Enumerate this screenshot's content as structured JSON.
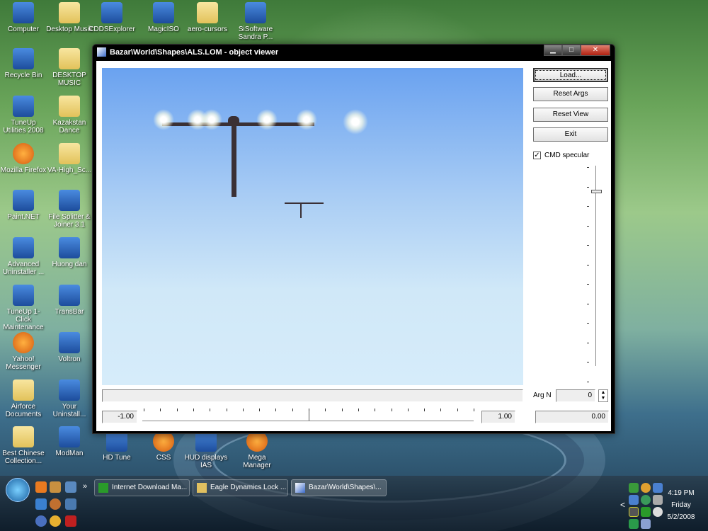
{
  "desktop_icons": [
    {
      "label": "Computer",
      "kind": "computer-icon"
    },
    {
      "label": "Desktop Musik",
      "kind": "folder-icon"
    },
    {
      "label": "CDDSExplorer",
      "kind": "modman-icon"
    },
    {
      "label": "MagicISO",
      "kind": "disc-icon"
    },
    {
      "label": "aero-cursors",
      "kind": "folder-icon"
    },
    {
      "label": "SiSoftware Sandra P...",
      "kind": "sandra-icon"
    },
    {
      "label": "Recycle Bin",
      "kind": "recycle-bin-icon"
    },
    {
      "label": "DESKTOP MUSIC",
      "kind": "folder-icon"
    },
    {
      "label": "TuneUp Utilities 2008",
      "kind": "tuneup-icon"
    },
    {
      "label": "Kazakstan Dance",
      "kind": "folder-icon"
    },
    {
      "label": "Mozilla Firefox",
      "kind": "firefox-icon"
    },
    {
      "label": "VA-High_Sc...",
      "kind": "folder-icon"
    },
    {
      "label": "Paint.NET",
      "kind": "paint-icon"
    },
    {
      "label": "File Splitter & Joiner 3.1",
      "kind": "file-splitter-icon"
    },
    {
      "label": "Advanced Uninstaller ...",
      "kind": "uninstaller-icon"
    },
    {
      "label": "Huong dan",
      "kind": "word-doc-icon"
    },
    {
      "label": "TuneUp 1-Click Maintenance",
      "kind": "tuneup-maintenance-icon"
    },
    {
      "label": "TransBar",
      "kind": "transbar-icon"
    },
    {
      "label": "Yahoo! Messenger",
      "kind": "yahoo-icon"
    },
    {
      "label": "Voltron",
      "kind": "text-file-icon"
    },
    {
      "label": "Airforce Documents",
      "kind": "folder-icon"
    },
    {
      "label": "Your Uninstall...",
      "kind": "your-uninstaller-icon"
    },
    {
      "label": "Best Chinese Collection...",
      "kind": "folder-icon"
    },
    {
      "label": "ModMan",
      "kind": "modman-icon"
    },
    {
      "label": "HD Tune",
      "kind": "hdtune-icon"
    },
    {
      "label": "CSS",
      "kind": "css-icon"
    },
    {
      "label": "HUD displays IAS",
      "kind": "word-doc-icon"
    },
    {
      "label": "Mega Manager",
      "kind": "mega-manager-icon"
    }
  ],
  "window": {
    "title": "Bazar\\World\\Shapes\\ALS.LOM - object viewer",
    "buttons": {
      "load": "Load...",
      "reset_args": "Reset Args",
      "reset_view": "Reset View",
      "exit": "Exit"
    },
    "cmd_specular": {
      "label": "CMD specular",
      "checked": true
    },
    "arg_n_label": "Arg N",
    "arg_n_value": "0",
    "slider_min": "-1.00",
    "slider_max": "1.00",
    "slider_value": "0.00",
    "slider_position_fraction": 0.5
  },
  "taskbar": {
    "tasks": [
      "Internet Download Ma...",
      "Eagle Dynamics Lock ...",
      "Bazar\\World\\Shapes\\..."
    ],
    "overflow": "»",
    "clock": {
      "time": "4:19 PM",
      "day": "Friday",
      "date": "5/2/2008"
    },
    "tray_expand": "<"
  }
}
